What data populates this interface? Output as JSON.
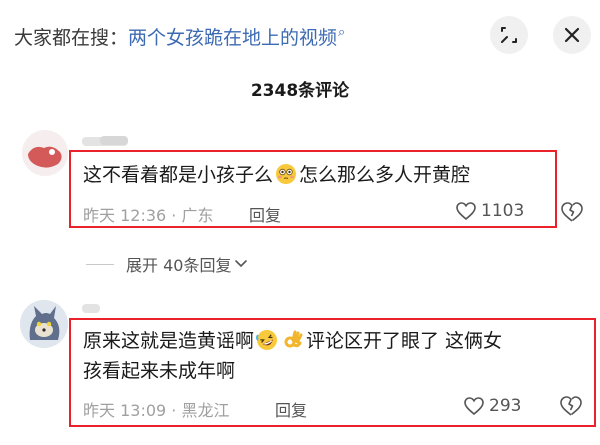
{
  "header": {
    "search_prefix": "大家都在搜：",
    "search_query": "两个女孩跪在地上的视频",
    "search_arrow": "⌕",
    "expand_icon": "expand-icon",
    "close_icon": "close-icon"
  },
  "comment_count": "2348条评论",
  "comments": [
    {
      "text_before": "这不看着都是小孩子么",
      "text_after": "怎么那么多人开黄腔",
      "emojis": [
        "flushed-face-emoji"
      ],
      "date": "昨天",
      "time": "12:36",
      "location": "广东",
      "reply_label": "回复",
      "likes": "1103",
      "highlight_color": "#e8212a"
    },
    {
      "text_line1_before": "原来这就是造黄谣啊",
      "text_line1_after": "评论区开了眼了 这俩女",
      "text_line2": "孩看起来未成年啊",
      "emojis": [
        "rolling-laughing-emoji",
        "ok-hand-emoji"
      ],
      "date": "昨天",
      "time": "13:09",
      "location": "黑龙江",
      "reply_label": "回复",
      "likes": "293",
      "highlight_color": "#e8212a"
    }
  ],
  "expand_replies": {
    "label": "展开 40条回复",
    "chevron": "chevron-down-icon"
  }
}
